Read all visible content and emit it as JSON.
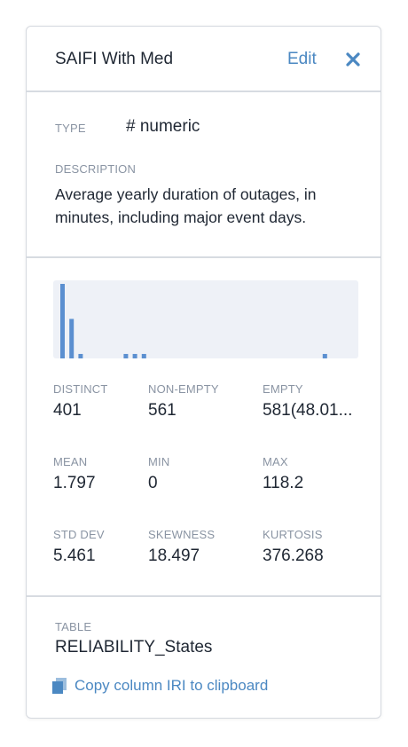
{
  "header": {
    "title": "SAIFI With Med",
    "edit_label": "Edit",
    "close_icon": "close-icon"
  },
  "type": {
    "label": "TYPE",
    "value": "# numeric"
  },
  "description": {
    "label": "DESCRIPTION",
    "value": "Average yearly duration of outages, in minutes, including major event days."
  },
  "histogram": {
    "bar_color": "#5b8fd0",
    "background": "#eef1f7",
    "bins": [
      1.0,
      0.53,
      0.06,
      0,
      0,
      0,
      0,
      0.06,
      0.06,
      0.06,
      0,
      0,
      0,
      0,
      0,
      0,
      0,
      0,
      0,
      0,
      0,
      0,
      0,
      0,
      0,
      0,
      0,
      0,
      0,
      0.06
    ]
  },
  "stats": {
    "distinct": {
      "label": "DISTINCT",
      "value": "401"
    },
    "non_empty": {
      "label": "NON-EMPTY",
      "value": "561"
    },
    "empty": {
      "label": "EMPTY",
      "value": "581(48.01..."
    },
    "mean": {
      "label": "MEAN",
      "value": "1.797"
    },
    "min": {
      "label": "MIN",
      "value": "0"
    },
    "max": {
      "label": "MAX",
      "value": "118.2"
    },
    "std_dev": {
      "label": "STD DEV",
      "value": "5.461"
    },
    "skewness": {
      "label": "SKEWNESS",
      "value": "18.497"
    },
    "kurtosis": {
      "label": "KURTOSIS",
      "value": "376.268"
    }
  },
  "table": {
    "label": "TABLE",
    "value": "RELIABILITY_States"
  },
  "copy_link": {
    "label": "Copy column IRI to clipboard",
    "icon": "copy-icon"
  },
  "colors": {
    "accent": "#4b88c2",
    "muted": "#8a94a3",
    "text": "#1f2733",
    "divider": "#d7dbe1"
  }
}
